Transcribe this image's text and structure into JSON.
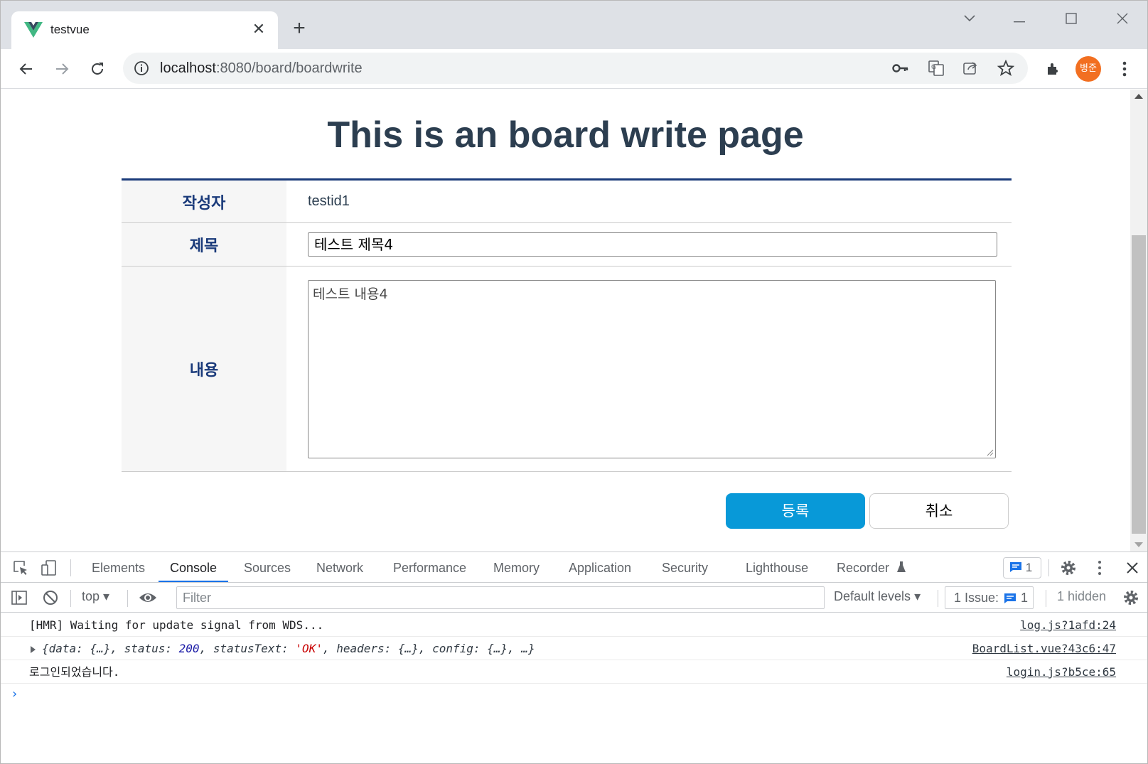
{
  "browser": {
    "tab_title": "testvue",
    "url_host": "localhost",
    "url_rest": ":8080/board/boardwrite",
    "profile_initials": "병준"
  },
  "page": {
    "title": "This is an board write page",
    "author_label": "작성자",
    "author_value": "testid1",
    "title_label": "제목",
    "title_value": "테스트 제목4",
    "content_label": "내용",
    "content_value": "테스트 내용4",
    "submit_label": "등록",
    "cancel_label": "취소",
    "colors": {
      "heading": "#2c3e50",
      "label": "#1a3a7a",
      "submit": "#0899d8"
    }
  },
  "devtools": {
    "tabs": [
      "Elements",
      "Console",
      "Sources",
      "Network",
      "Performance",
      "Memory",
      "Application",
      "Security",
      "Lighthouse",
      "Recorder"
    ],
    "active_tab": "Console",
    "message_badge_count": "1",
    "context": "top",
    "filter_placeholder": "Filter",
    "levels": "Default levels",
    "issues_label": "1 Issue:",
    "issues_count": "1",
    "hidden": "1 hidden",
    "logs": [
      {
        "text": "[HMR] Waiting for update signal from WDS...",
        "source": "log.js?1afd:24"
      },
      {
        "obj_open": "{data: {…}, status: ",
        "status_num": "200",
        "mid": ", statusText: ",
        "status_text": "'OK'",
        "obj_close": ", headers: {…}, config: {…}, …}",
        "source": "BoardList.vue?43c6:47"
      },
      {
        "text": "로그인되었습니다.",
        "source": "login.js?b5ce:65"
      }
    ]
  }
}
